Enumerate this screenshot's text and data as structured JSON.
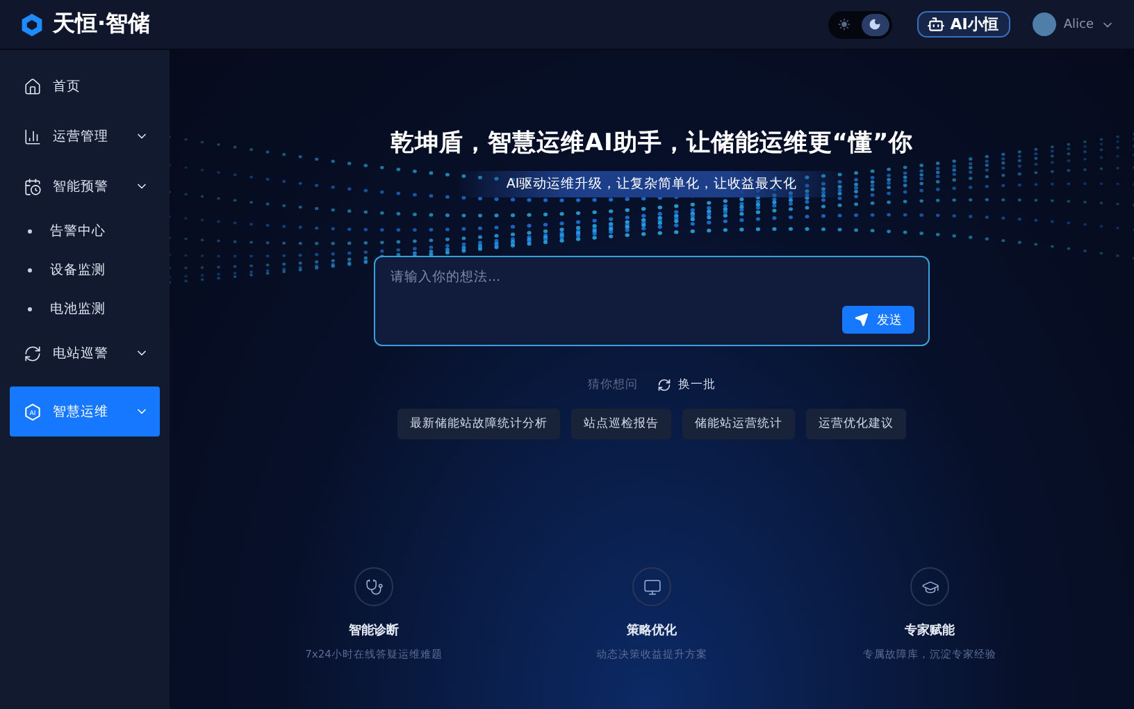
{
  "header": {
    "brand": "天恒·智储",
    "theme_toggle": [
      {
        "kind": "light",
        "selected": false
      },
      {
        "kind": "dark",
        "selected": true
      }
    ],
    "assistant_button": "AI小恒",
    "user": {
      "name": "Alice"
    }
  },
  "sidebar": {
    "items": [
      {
        "label": "首页",
        "kind": "link",
        "selected": false
      },
      {
        "label": "运营管理",
        "kind": "group",
        "selected": false
      },
      {
        "label": "智能预警",
        "kind": "group",
        "expanded": true,
        "selected": false,
        "children": [
          {
            "label": "告警中心",
            "selected": false
          },
          {
            "label": "设备监测",
            "selected": false
          },
          {
            "label": "电池监测",
            "selected": false
          }
        ]
      },
      {
        "label": "电站巡警",
        "kind": "group",
        "selected": false
      },
      {
        "label": "智慧运维",
        "kind": "group",
        "icon_text": "AI",
        "selected": true
      }
    ]
  },
  "hero": {
    "title": "乾坤盾，智慧运维AI助手，让储能运维更“懂”你",
    "subtitle": "AI驱动运维升级，让复杂简单化，让收益最大化"
  },
  "prompt": {
    "placeholder": "请输入你的想法...",
    "send_button": "发送"
  },
  "suggestions": {
    "label": "猜你想问",
    "refresh": "换一批",
    "items": [
      "最新储能站故障统计分析",
      "站点巡检报告",
      "储能站运营统计",
      "运营优化建议"
    ]
  },
  "features": [
    {
      "title": "智能诊断",
      "description": "7x24小时在线答疑运维难题"
    },
    {
      "title": "策略优化",
      "description": "动态决策收益提升方案"
    },
    {
      "title": "专家赋能",
      "description": "专属故障库，沉淀专家经验"
    }
  ]
}
